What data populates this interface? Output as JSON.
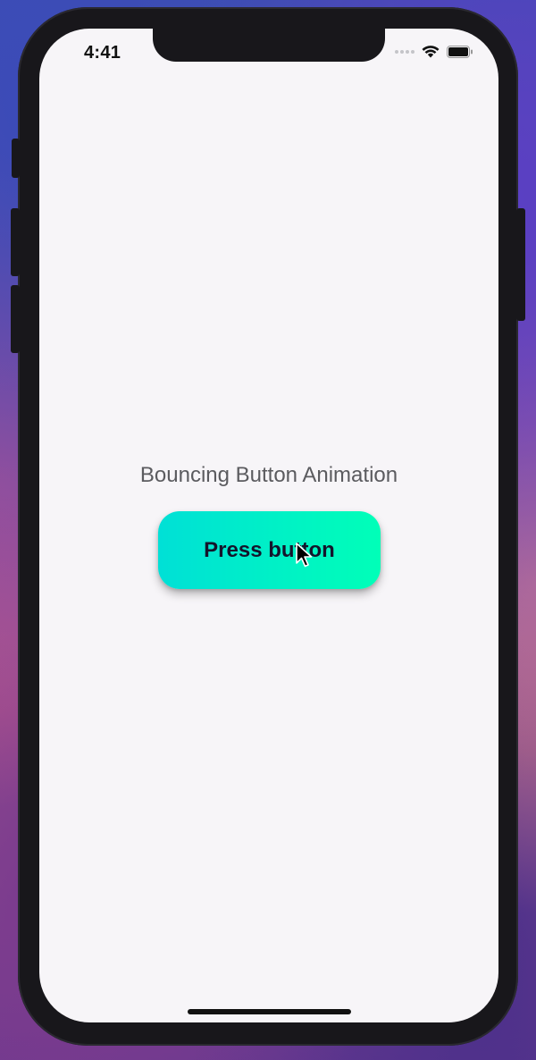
{
  "status_bar": {
    "time": "4:41",
    "icons": [
      "signal-dots-icon",
      "wifi-icon",
      "battery-icon"
    ]
  },
  "main": {
    "title": "Bouncing Button Animation",
    "button_label": "Press button"
  },
  "colors": {
    "screen_bg": "#f7f5f8",
    "frame": "#18171b",
    "button_gradient_start": "#00e0d6",
    "button_gradient_end": "#00ffb8",
    "button_text": "#14142b",
    "title_text": "#5b5b5f"
  }
}
